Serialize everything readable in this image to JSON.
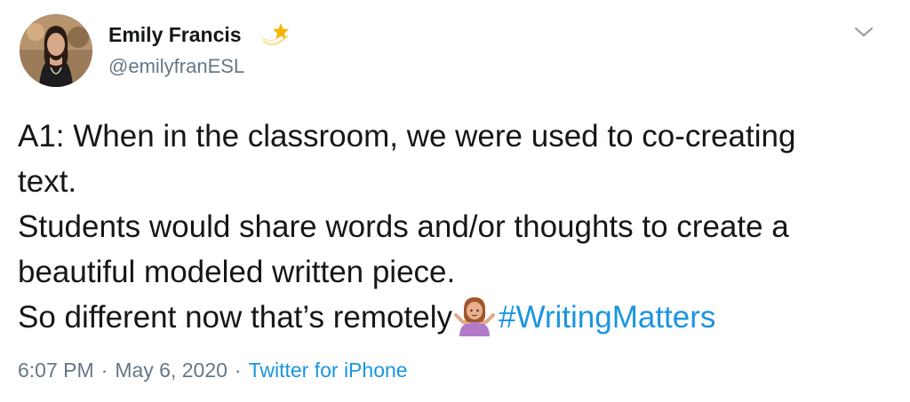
{
  "author": {
    "name": "Emily Francis",
    "handle": "@emilyfranESL",
    "name_decoration_icon": "shooting-star-icon"
  },
  "tweet": {
    "lines": [
      "A1: When in the classroom, we were used to co-creating",
      "text.",
      "Students would share words and/or thoughts to create a",
      "beautiful modeled written piece.",
      "So different now that’s remotely"
    ],
    "emoji": "person-shrugging-icon",
    "hashtag": "#WritingMatters"
  },
  "meta": {
    "time": "6:07 PM",
    "date": "May 6, 2020",
    "separator": "·",
    "source": "Twitter for iPhone"
  },
  "colors": {
    "text": "#14171a",
    "secondary": "#657786",
    "link": "#1b95e0"
  },
  "menu_icon": "chevron-down-icon"
}
